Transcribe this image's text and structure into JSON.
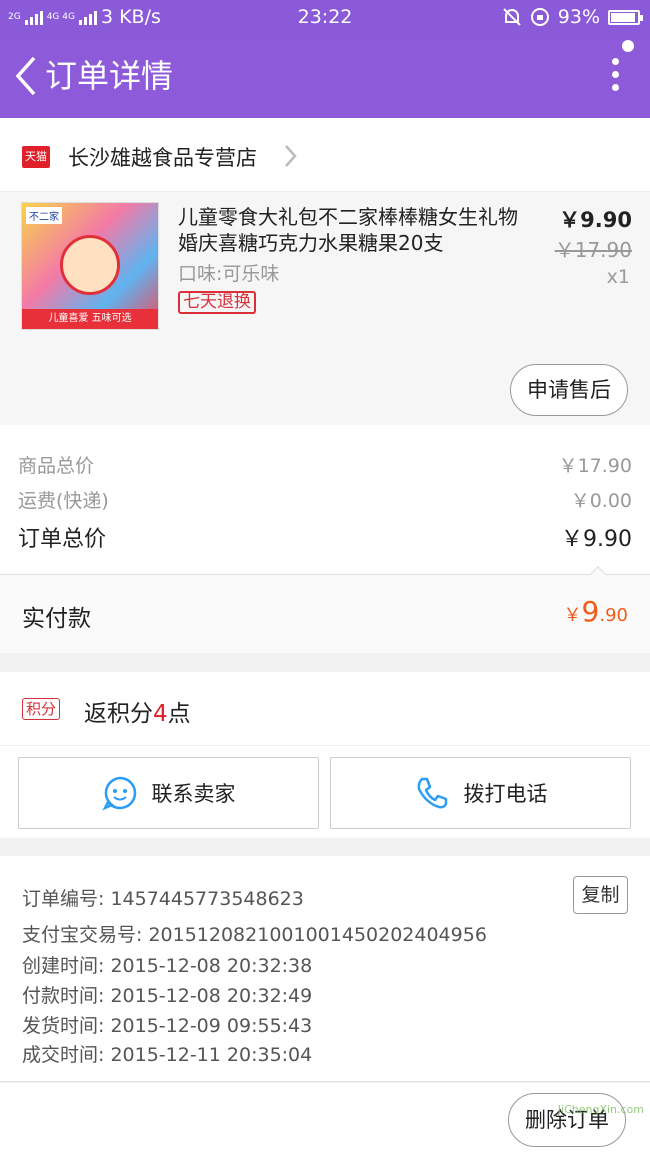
{
  "status_bar": {
    "net1": "2G",
    "net2": "4G 4G",
    "speed": "3 KB/s",
    "time": "23:22",
    "battery": "93%",
    "battery_level": 0.93
  },
  "nav": {
    "title": "订单详情"
  },
  "shop": {
    "badge": "天猫",
    "name": "长沙雄越食品专营店"
  },
  "product": {
    "image_brand": "不二家",
    "image_caption": "儿童喜爱 五味可选",
    "title": "儿童零食大礼包不二家棒棒糖女生礼物婚庆喜糖巧克力水果糖果20支",
    "flavor": "口味:可乐味",
    "return_badge": "七天退换",
    "price": "￥9.90",
    "original_price": "￥17.90",
    "quantity": "x1",
    "after_sale_label": "申请售后"
  },
  "totals": {
    "goods_label": "商品总价",
    "goods_value": "￥17.90",
    "shipping_label": "运费(快递)",
    "shipping_value": "￥0.00",
    "order_label": "订单总价",
    "order_value": "￥9.90"
  },
  "paid": {
    "label": "实付款",
    "symbol": "￥",
    "int": "9",
    "dec": ".90"
  },
  "points": {
    "tag": "积分",
    "prefix": "返积分",
    "number": "4",
    "suffix": "点"
  },
  "actions": {
    "contact_seller": "联系卖家",
    "call": "拨打电话"
  },
  "order_info": {
    "order_no": "订单编号: 1457445773548623",
    "copy_label": "复制",
    "alipay_no": "支付宝交易号: 2015120821001001450202404956",
    "created": "创建时间: 2015-12-08 20:32:38",
    "paid": "付款时间: 2015-12-08 20:32:49",
    "shipped": "发货时间: 2015-12-09 09:55:43",
    "completed": "成交时间: 2015-12-11 20:35:04"
  },
  "footer": {
    "delete_label": "删除订单",
    "watermark": "JiChengXin.com"
  },
  "colors": {
    "nav_bg": "#8d5bd9",
    "accent_red": "#e0202a",
    "paid_orange": "#f25a1a"
  }
}
